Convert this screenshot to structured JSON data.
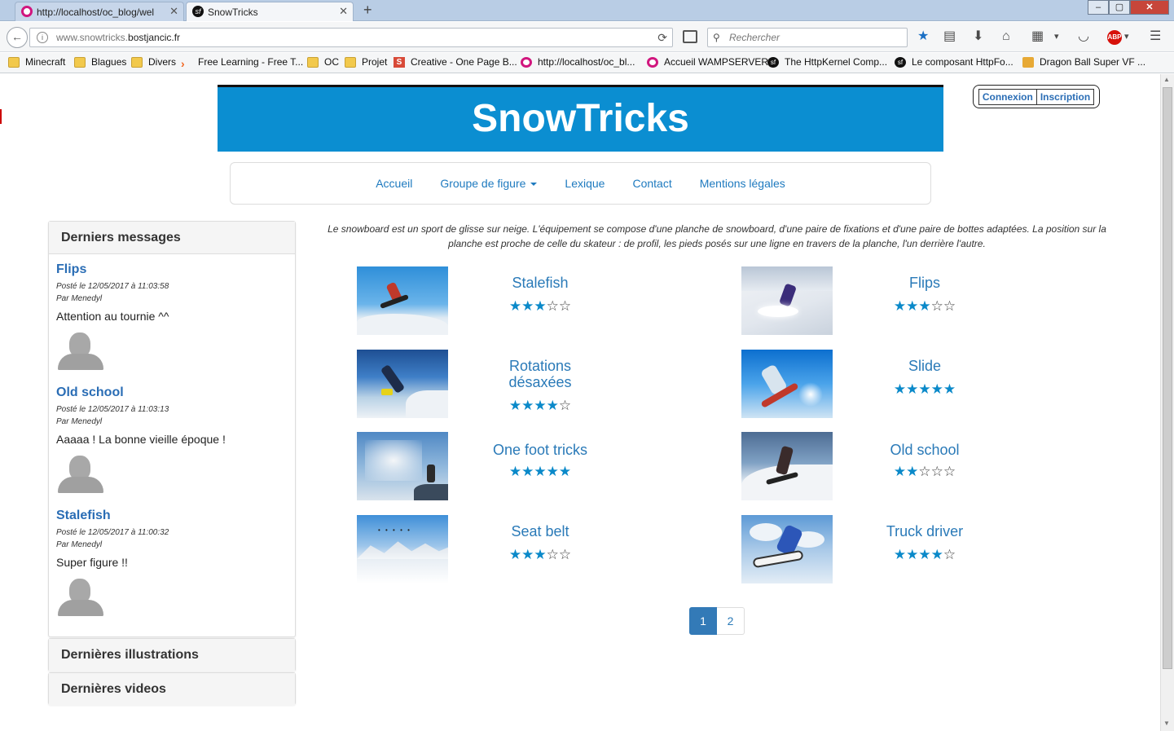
{
  "browser": {
    "tabs": [
      {
        "title": "http://localhost/oc_blog/wel",
        "icon": "wamp-icon"
      },
      {
        "title": "SnowTricks",
        "icon": "symfony-icon"
      }
    ],
    "url_prefix": "www.snowtricks.",
    "url_domain": "bostjancic.fr",
    "search_placeholder": "Rechercher",
    "bookmarks": [
      {
        "label": "Minecraft",
        "icon": "folder"
      },
      {
        "label": "Blagues",
        "icon": "folder"
      },
      {
        "label": "Divers",
        "icon": "folder"
      },
      {
        "label": "Free Learning - Free T...",
        "icon": "chevron"
      },
      {
        "label": "OC",
        "icon": "folder"
      },
      {
        "label": "Projet",
        "icon": "folder"
      },
      {
        "label": "Creative - One Page B...",
        "icon": "s-logo"
      },
      {
        "label": "http://localhost/oc_bl...",
        "icon": "wamp"
      },
      {
        "label": "Accueil WAMPSERVER",
        "icon": "wamp"
      },
      {
        "label": "The HttpKernel Comp...",
        "icon": "symfony"
      },
      {
        "label": "Le composant HttpFo...",
        "icon": "symfony"
      },
      {
        "label": "Dragon Ball Super VF ...",
        "icon": "dragonball"
      }
    ]
  },
  "site": {
    "title": "SnowTricks",
    "auth": {
      "login": "Connexion",
      "register": "Inscription"
    },
    "nav": [
      "Accueil",
      "Groupe de figure",
      "Lexique",
      "Contact",
      "Mentions légales"
    ],
    "intro": "Le snowboard est un sport de glisse sur neige. L'équipement se compose d'une planche de snowboard, d'une paire de fixations et d'une paire de bottes adaptées. La position sur la planche est proche de celle du skateur : de profil, les pieds posés sur une ligne en travers de la planche, l'un derrière l'autre."
  },
  "sidebar": {
    "messages_title": "Derniers messages",
    "messages": [
      {
        "title": "Flips",
        "date": "Posté le 12/05/2017 à 11:03:58",
        "author": "Par Menedyl",
        "text": "Attention au tournie ^^"
      },
      {
        "title": "Old school",
        "date": "Posté le 12/05/2017 à 11:03:13",
        "author": "Par Menedyl",
        "text": "Aaaaa ! La bonne vieille époque !"
      },
      {
        "title": "Stalefish",
        "date": "Posté le 12/05/2017 à 11:00:32",
        "author": "Par Menedyl",
        "text": "Super figure !!"
      }
    ],
    "illustrations_title": "Dernières illustrations",
    "videos_title": "Dernières videos"
  },
  "tricks": [
    {
      "name": "Stalefish",
      "rating": 3
    },
    {
      "name": "Flips",
      "rating": 3
    },
    {
      "name": "Rotations désaxées",
      "rating": 4
    },
    {
      "name": "Slide",
      "rating": 5
    },
    {
      "name": "One foot tricks",
      "rating": 5
    },
    {
      "name": "Old school",
      "rating": 2
    },
    {
      "name": "Seat belt",
      "rating": 3
    },
    {
      "name": "Truck driver",
      "rating": 4
    }
  ],
  "pagination": {
    "pages": [
      "1",
      "2"
    ],
    "current": "1"
  },
  "colors": {
    "brand": "#0b8ed1",
    "link": "#2a7ab8",
    "star": "#0a89c9"
  }
}
